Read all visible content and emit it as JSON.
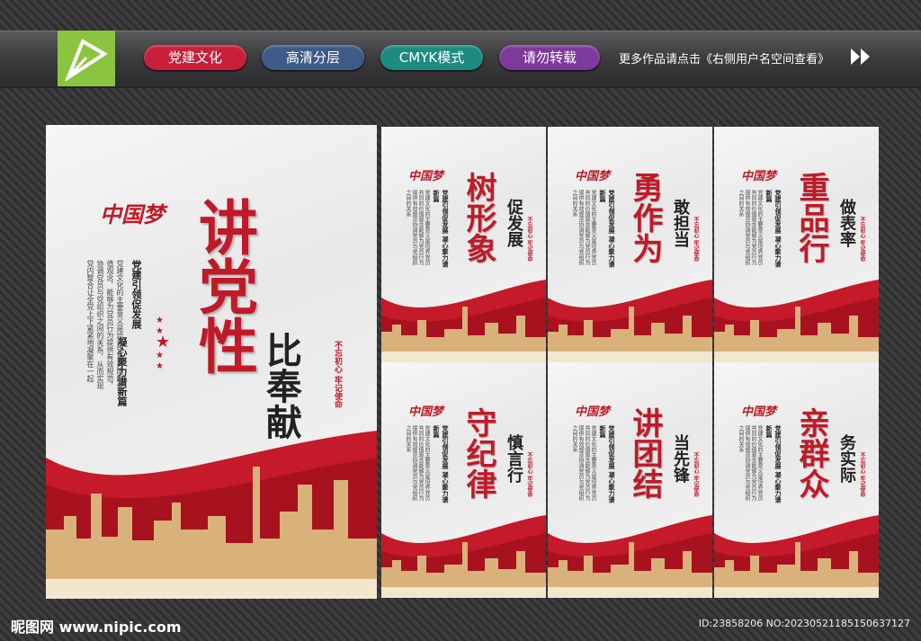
{
  "header": {
    "tags": [
      "党建文化",
      "高清分层",
      "CMYK模式",
      "请勿转载"
    ],
    "more_text": "更多作品请点击《右侧用户名空间查看》"
  },
  "main_poster": {
    "brand": "中国梦",
    "title_line1": "讲党性",
    "title_line2": "比奉献",
    "subtitle_left": "党建引领促发展",
    "subtitle_right": "凝心聚力谱新篇",
    "stamp": "不忘初心 牢记使命",
    "paragraph": "党建文化的主要意义是培养党员共同的价值观念，能够为党员行为提供有效规范，协调党员与党组织之间的关系，从而实现党内整合让全党上下紧紧地凝聚在一起"
  },
  "small_posters": [
    {
      "title": "树形象",
      "sub": "促发展"
    },
    {
      "title": "勇作为",
      "sub": "敢担当"
    },
    {
      "title": "重品行",
      "sub": "做表率"
    },
    {
      "title": "守纪律",
      "sub": "慎言行"
    },
    {
      "title": "讲团结",
      "sub": "当先锋"
    },
    {
      "title": "亲群众",
      "sub": "务实际"
    }
  ],
  "small_common": {
    "brand": "中国梦",
    "subtitle": "党建引领促发展 凝心聚力谱新篇",
    "stamp": "不忘初心 牢记使命",
    "paragraph": "党建文化的主要意义是培养党员共同的价值观念能够为党员行为提供有效规范协调党员与党组织之间的关系"
  },
  "footer": {
    "site": "昵图网 www.nipic.com",
    "id": "ID:23858206 NO:20230521185150637127"
  },
  "colors": {
    "accent": "#c01a28",
    "logo_bg": "#8bc43f"
  }
}
